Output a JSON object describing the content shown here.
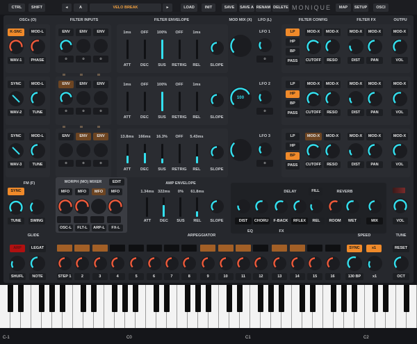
{
  "topbar": {
    "ctrl": "CTRL",
    "shift": "SHIFT",
    "prev": "◂",
    "bank": "A",
    "preset": "VELO BREAK",
    "next": "▸",
    "load": "LOAD",
    "init": "INIT",
    "save": "SAVE",
    "save_as": "SAVE A",
    "rename": "RENAM",
    "delete": "DELETE",
    "brand": "MONIQUE",
    "map": "MAP",
    "setup": "SETUP",
    "osci": "OSCI"
  },
  "sections": {
    "oscs": "OSCs (O)",
    "filter_inputs": "FILTER INPUTS",
    "filter_envelope": "FILTER ENVELOPE",
    "mod_mix": "MOD MIX (X)",
    "lfo_l": "LFO (L)",
    "filter_config": "FILTER CONFIG",
    "filter_fx": "FILTER FX",
    "output": "OUTPU",
    "fm": "FM (F)",
    "morph": "MORPH (MO) MIXER",
    "amp_envelope": "AMP ENVELOPE",
    "glide": "GLIDE",
    "arpeggiator": "ARPEGGIATOR",
    "speed": "SPEED",
    "tune": "TUNE"
  },
  "osc_rows": [
    {
      "btn1": "K-SNC",
      "btn2": "MOD-L",
      "k1": "WAV-1",
      "k2": "PHASE"
    },
    {
      "btn1": "SYNC",
      "btn2": "MOD-L",
      "k1": "WAV-2",
      "k2": "TUNE"
    },
    {
      "btn1": "SYNC",
      "btn2": "MOD-L",
      "k1": "WAV-3",
      "k2": "TUNE"
    }
  ],
  "filter_rows": [
    {
      "env": [
        "ENV",
        "ENV",
        "ENV"
      ],
      "inputs": [
        "o",
        "o",
        "o"
      ],
      "env_vals": [
        "1ms",
        "OFF",
        "100%",
        "OFF",
        "1ms"
      ],
      "env_labels": [
        "ATT",
        "DEC",
        "SUS",
        "RETRIG",
        "REL"
      ],
      "slope": "SLOPE",
      "lfo": "LFO 1",
      "lfo_val": "o",
      "modes": [
        "LP",
        "HP",
        "BP",
        "PASS"
      ],
      "cfg": [
        "MOD-X",
        "MOD-X",
        "CUTOFF",
        "RESO"
      ],
      "fx": [
        "MOD-X",
        "MOD-X",
        "DIST",
        "PAN"
      ],
      "out": [
        "MOD-X",
        "VOL"
      ],
      "mix_val": ""
    },
    {
      "env": [
        "ENV",
        "ENV",
        "ENV"
      ],
      "inputs": [
        "o",
        "o",
        "o"
      ],
      "env_vals": [
        "1ms",
        "OFF",
        "100%",
        "OFF",
        "1ms"
      ],
      "env_labels": [
        "ATT",
        "DEC",
        "SUS",
        "RETRIG",
        "REL"
      ],
      "slope": "SLOPE",
      "lfo": "LFO 2",
      "lfo_val": "o",
      "modes": [
        "LP",
        "HP",
        "BP",
        "PASS"
      ],
      "cfg": [
        "MOD-X",
        "MOD-X",
        "CUTOFF",
        "RESO"
      ],
      "fx": [
        "MOD-X",
        "MOD-X",
        "DIST",
        "PAN"
      ],
      "out": [
        "MOD-X",
        "VOL"
      ],
      "mix_val": "100"
    },
    {
      "env": [
        "ENV",
        "ENV",
        "ENV"
      ],
      "inputs": [
        "o",
        "o",
        "o"
      ],
      "env_vals": [
        "13.8ms",
        "166ms",
        "16.3%",
        "OFF",
        "5.43ms"
      ],
      "env_labels": [
        "ATT",
        "DEC",
        "SUS",
        "RETRIG",
        "REL"
      ],
      "slope": "SLOPE",
      "lfo": "LFO 3",
      "lfo_val": "o",
      "modes": [
        "LP",
        "HP",
        "BP",
        "PASS"
      ],
      "cfg": [
        "MOD-X",
        "MOD-X",
        "CUTOFF",
        "RESO"
      ],
      "fx": [
        "MOD-X",
        "MOD-X",
        "DIST",
        "PAN"
      ],
      "out": [
        "MOD-X",
        "VOL"
      ],
      "mix_val": ""
    }
  ],
  "fm": {
    "sync": "SYNC",
    "tune": "TUNE",
    "swing": "SWING"
  },
  "morph": {
    "edit": "EDIT",
    "mfo": [
      "MFO",
      "MFO",
      "MFO",
      "MFO"
    ],
    "targets": [
      "OSC-L",
      "FLT-L",
      "ARP-L",
      "FX-L"
    ]
  },
  "amp": {
    "vals": [
      "1.34ms",
      "322ms",
      "0%",
      "61.8ms"
    ],
    "labels": [
      "ATT",
      "DEC",
      "SUS",
      "REL"
    ],
    "slope": "SLOPE"
  },
  "fx": {
    "delay": "DELAY",
    "fill": "FILL",
    "reverb": "REVERB",
    "knobs": [
      "DIST",
      "CHORU",
      "F-BACK",
      "RFLEX",
      "REL",
      "ROOM",
      "WET",
      "MIX"
    ],
    "tabs": [
      "EQ",
      "FX"
    ],
    "vol": "VOL"
  },
  "glide": {
    "arp": "ARP",
    "legato": "LEGAT",
    "shuffle": "SHUFL",
    "note": "NOTE"
  },
  "arp_steps": [
    "STEP 1",
    "2",
    "3",
    "4",
    "5",
    "6",
    "7",
    "8",
    "9",
    "10",
    "11",
    "12",
    "13",
    "14",
    "15",
    "16"
  ],
  "arp_step_states": [
    1,
    1,
    1,
    0,
    0,
    0,
    0,
    0,
    1,
    1,
    1,
    0,
    1,
    1,
    0,
    0
  ],
  "speed": {
    "sync": "SYNC",
    "mult": "x1",
    "bpm": "130 BP",
    "x1": "x1"
  },
  "tune_ctrl": {
    "reset": "RESET",
    "oct": "OCT"
  },
  "keyboard": {
    "octaves": [
      "C-1",
      "C0",
      "C1",
      "C2"
    ]
  },
  "colors": {
    "accent": "#33e0ef",
    "orange": "#f08a2a",
    "red": "#f05a3a",
    "panel": "#2a2c31"
  }
}
